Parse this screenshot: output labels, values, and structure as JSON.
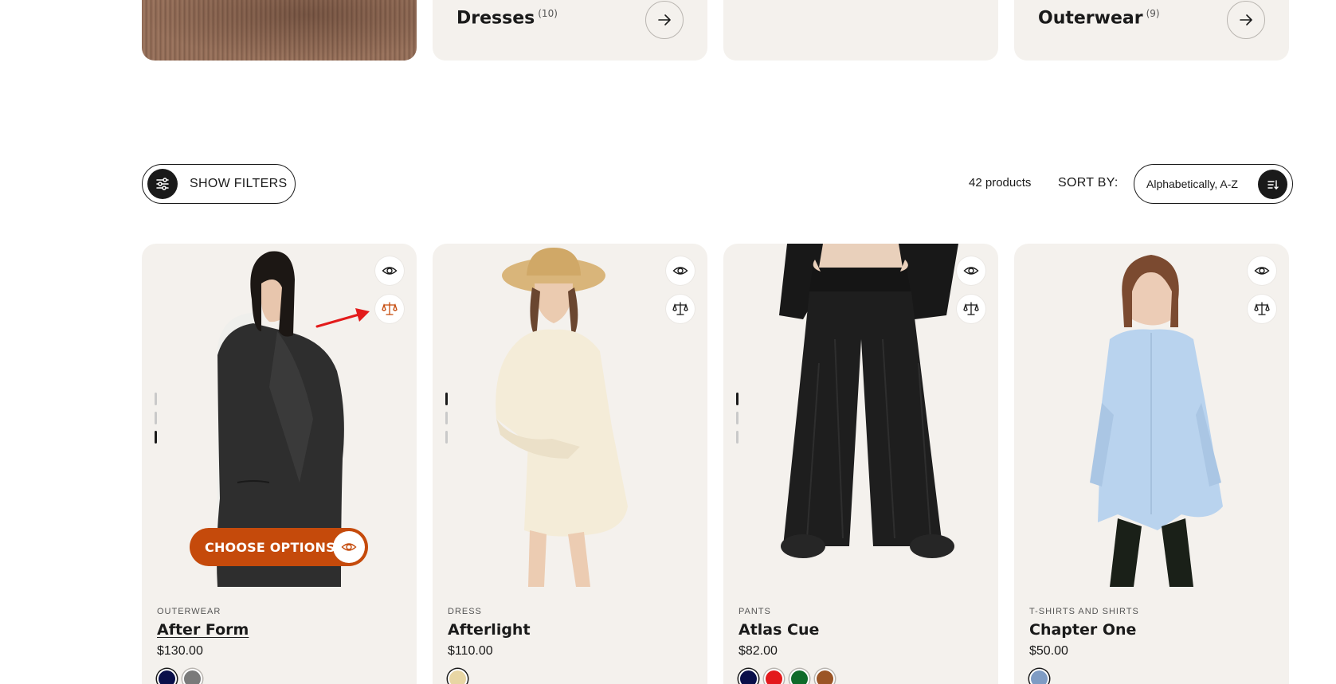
{
  "categories": [
    {
      "name": "",
      "count": "",
      "image": "knit-sweater-photo"
    },
    {
      "name": "Dresses",
      "count": "(10)"
    },
    {
      "name": "",
      "count": ""
    },
    {
      "name": "Outerwear",
      "count": "(9)"
    }
  ],
  "toolbar": {
    "filters_label": "SHOW FILTERS",
    "product_count": "42 products",
    "sort_label": "SORT BY:",
    "sort_value": "Alphabetically, A-Z"
  },
  "products": [
    {
      "category": "OUTERWEAR",
      "title": "After Form",
      "price": "$130.00",
      "choose_label": "CHOOSE OPTIONS",
      "swatches": [
        "#0a0f4a",
        "#7a7a7a"
      ],
      "image_dots_active": 3
    },
    {
      "category": "DRESS",
      "title": "Afterlight",
      "price": "$110.00",
      "swatches": [
        "#e8d6a4"
      ],
      "image_dots_active": 1
    },
    {
      "category": "PANTS",
      "title": "Atlas Cue",
      "price": "$82.00",
      "swatches": [
        "#0a0f4a",
        "#e3191c",
        "#0f6b2a",
        "#9b5526"
      ],
      "image_dots_active": 1
    },
    {
      "category": "T-SHIRTS AND SHIRTS",
      "title": "Chapter One",
      "price": "$50.00",
      "swatches": [
        "#7f9cc4"
      ]
    }
  ],
  "colors": {
    "card_bg": "#f4f1ed",
    "accent": "#c54a0b",
    "dark": "#1a1a1a",
    "annotation": "#e31b1b"
  },
  "icons": [
    "arrow-right-icon",
    "sliders-icon",
    "sort-icon",
    "eye-icon",
    "compare-scale-icon"
  ]
}
